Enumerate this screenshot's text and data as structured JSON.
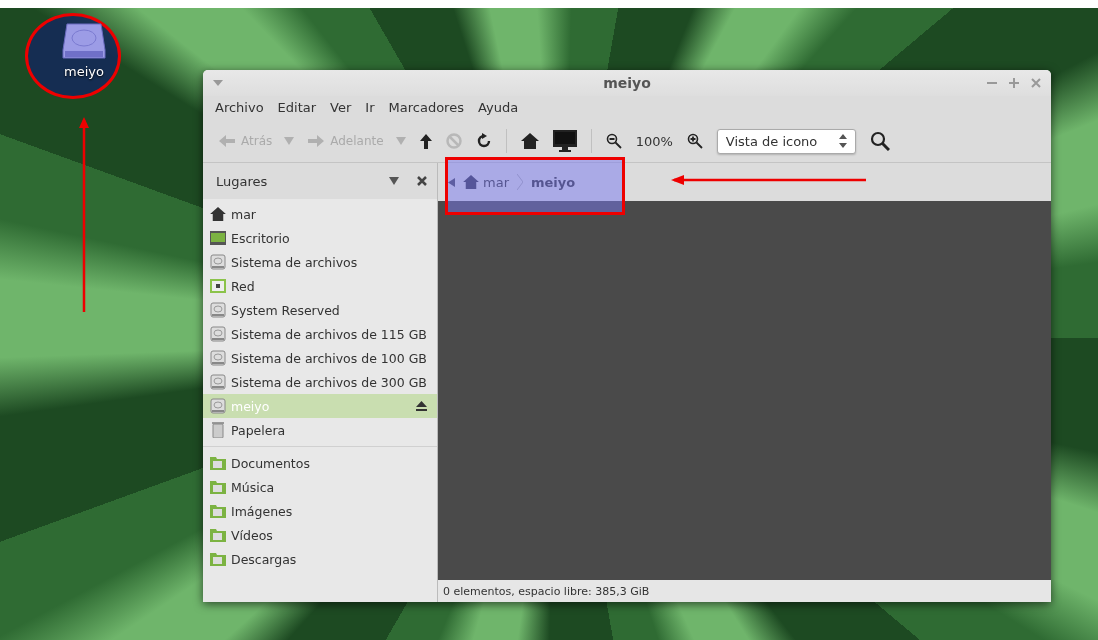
{
  "desktop_icon": {
    "label": "meiyo"
  },
  "window": {
    "title": "meiyo"
  },
  "menu": [
    {
      "label": "Archivo"
    },
    {
      "label": "Editar"
    },
    {
      "label": "Ver"
    },
    {
      "label": "Ir"
    },
    {
      "label": "Marcadores"
    },
    {
      "label": "Ayuda"
    }
  ],
  "toolbar": [
    {
      "kind": "back",
      "label": "Atrás",
      "disabled": true
    },
    {
      "kind": "forward",
      "label": "Adelante",
      "disabled": true
    },
    {
      "kind": "up",
      "disabled": false
    },
    {
      "kind": "stop",
      "disabled": true
    },
    {
      "kind": "reload",
      "disabled": false
    },
    {
      "kind": "separator"
    },
    {
      "kind": "home",
      "disabled": false
    },
    {
      "kind": "computer",
      "disabled": false
    },
    {
      "kind": "separator"
    },
    {
      "kind": "zoom_out",
      "disabled": false
    },
    {
      "kind": "zoom_level",
      "text": "100%"
    },
    {
      "kind": "zoom_in",
      "disabled": false
    },
    {
      "kind": "view_select",
      "value": "Vista de icono"
    },
    {
      "kind": "search",
      "disabled": false
    }
  ],
  "sidebar": {
    "title": "Lugares",
    "sections": [
      {
        "items": [
          {
            "label": "mar",
            "kind": "home",
            "selected": false,
            "ejectable": false
          },
          {
            "label": "Escritorio",
            "kind": "desktop",
            "selected": false,
            "ejectable": false
          },
          {
            "label": "Sistema de archivos",
            "kind": "drive",
            "selected": false,
            "ejectable": false
          },
          {
            "label": "Red",
            "kind": "network",
            "selected": false,
            "ejectable": false
          },
          {
            "label": "System Reserved",
            "kind": "drive",
            "selected": false,
            "ejectable": false
          },
          {
            "label": "Sistema de archivos de 115 GB",
            "kind": "drive",
            "selected": false,
            "ejectable": false
          },
          {
            "label": "Sistema de archivos de 100 GB",
            "kind": "drive",
            "selected": false,
            "ejectable": false
          },
          {
            "label": "Sistema de archivos de 300 GB",
            "kind": "drive",
            "selected": false,
            "ejectable": false
          },
          {
            "label": "meiyo",
            "kind": "drive",
            "selected": true,
            "ejectable": true
          },
          {
            "label": "Papelera",
            "kind": "trash",
            "selected": false,
            "ejectable": false
          }
        ]
      },
      {
        "items": [
          {
            "label": "Documentos",
            "kind": "folder",
            "selected": false,
            "ejectable": false
          },
          {
            "label": "Música",
            "kind": "folder",
            "selected": false,
            "ejectable": false
          },
          {
            "label": "Imágenes",
            "kind": "folder",
            "selected": false,
            "ejectable": false
          },
          {
            "label": "Vídeos",
            "kind": "folder",
            "selected": false,
            "ejectable": false
          },
          {
            "label": "Descargas",
            "kind": "folder",
            "selected": false,
            "ejectable": false
          }
        ]
      }
    ]
  },
  "pathbar": {
    "crumbs": [
      {
        "label": "mar",
        "kind": "home",
        "selected": false
      },
      {
        "label": "meiyo",
        "kind": "plain",
        "selected": true
      }
    ]
  },
  "status_bar": {
    "text": "0 elementos, espacio libre: 385,3 GiB"
  }
}
